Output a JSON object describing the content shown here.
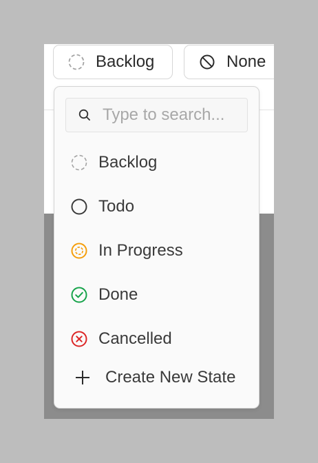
{
  "state_button": {
    "label": "Backlog",
    "icon": "backlog-dashed-circle-icon"
  },
  "priority_button": {
    "label": "None",
    "icon": "no-priority-icon"
  },
  "dropdown": {
    "search_placeholder": "Type to search...",
    "search_value": "",
    "options": [
      {
        "label": "Backlog",
        "icon": "backlog-dashed-circle-icon",
        "color": "#a3a3a3"
      },
      {
        "label": "Todo",
        "icon": "todo-circle-icon",
        "color": "#3a3a3a"
      },
      {
        "label": "In Progress",
        "icon": "in-progress-circle-icon",
        "color": "#f59e0b"
      },
      {
        "label": "Done",
        "icon": "done-check-circle-icon",
        "color": "#16a34a"
      },
      {
        "label": "Cancelled",
        "icon": "cancelled-x-circle-icon",
        "color": "#dc2626"
      }
    ],
    "create_label": "Create New State"
  }
}
